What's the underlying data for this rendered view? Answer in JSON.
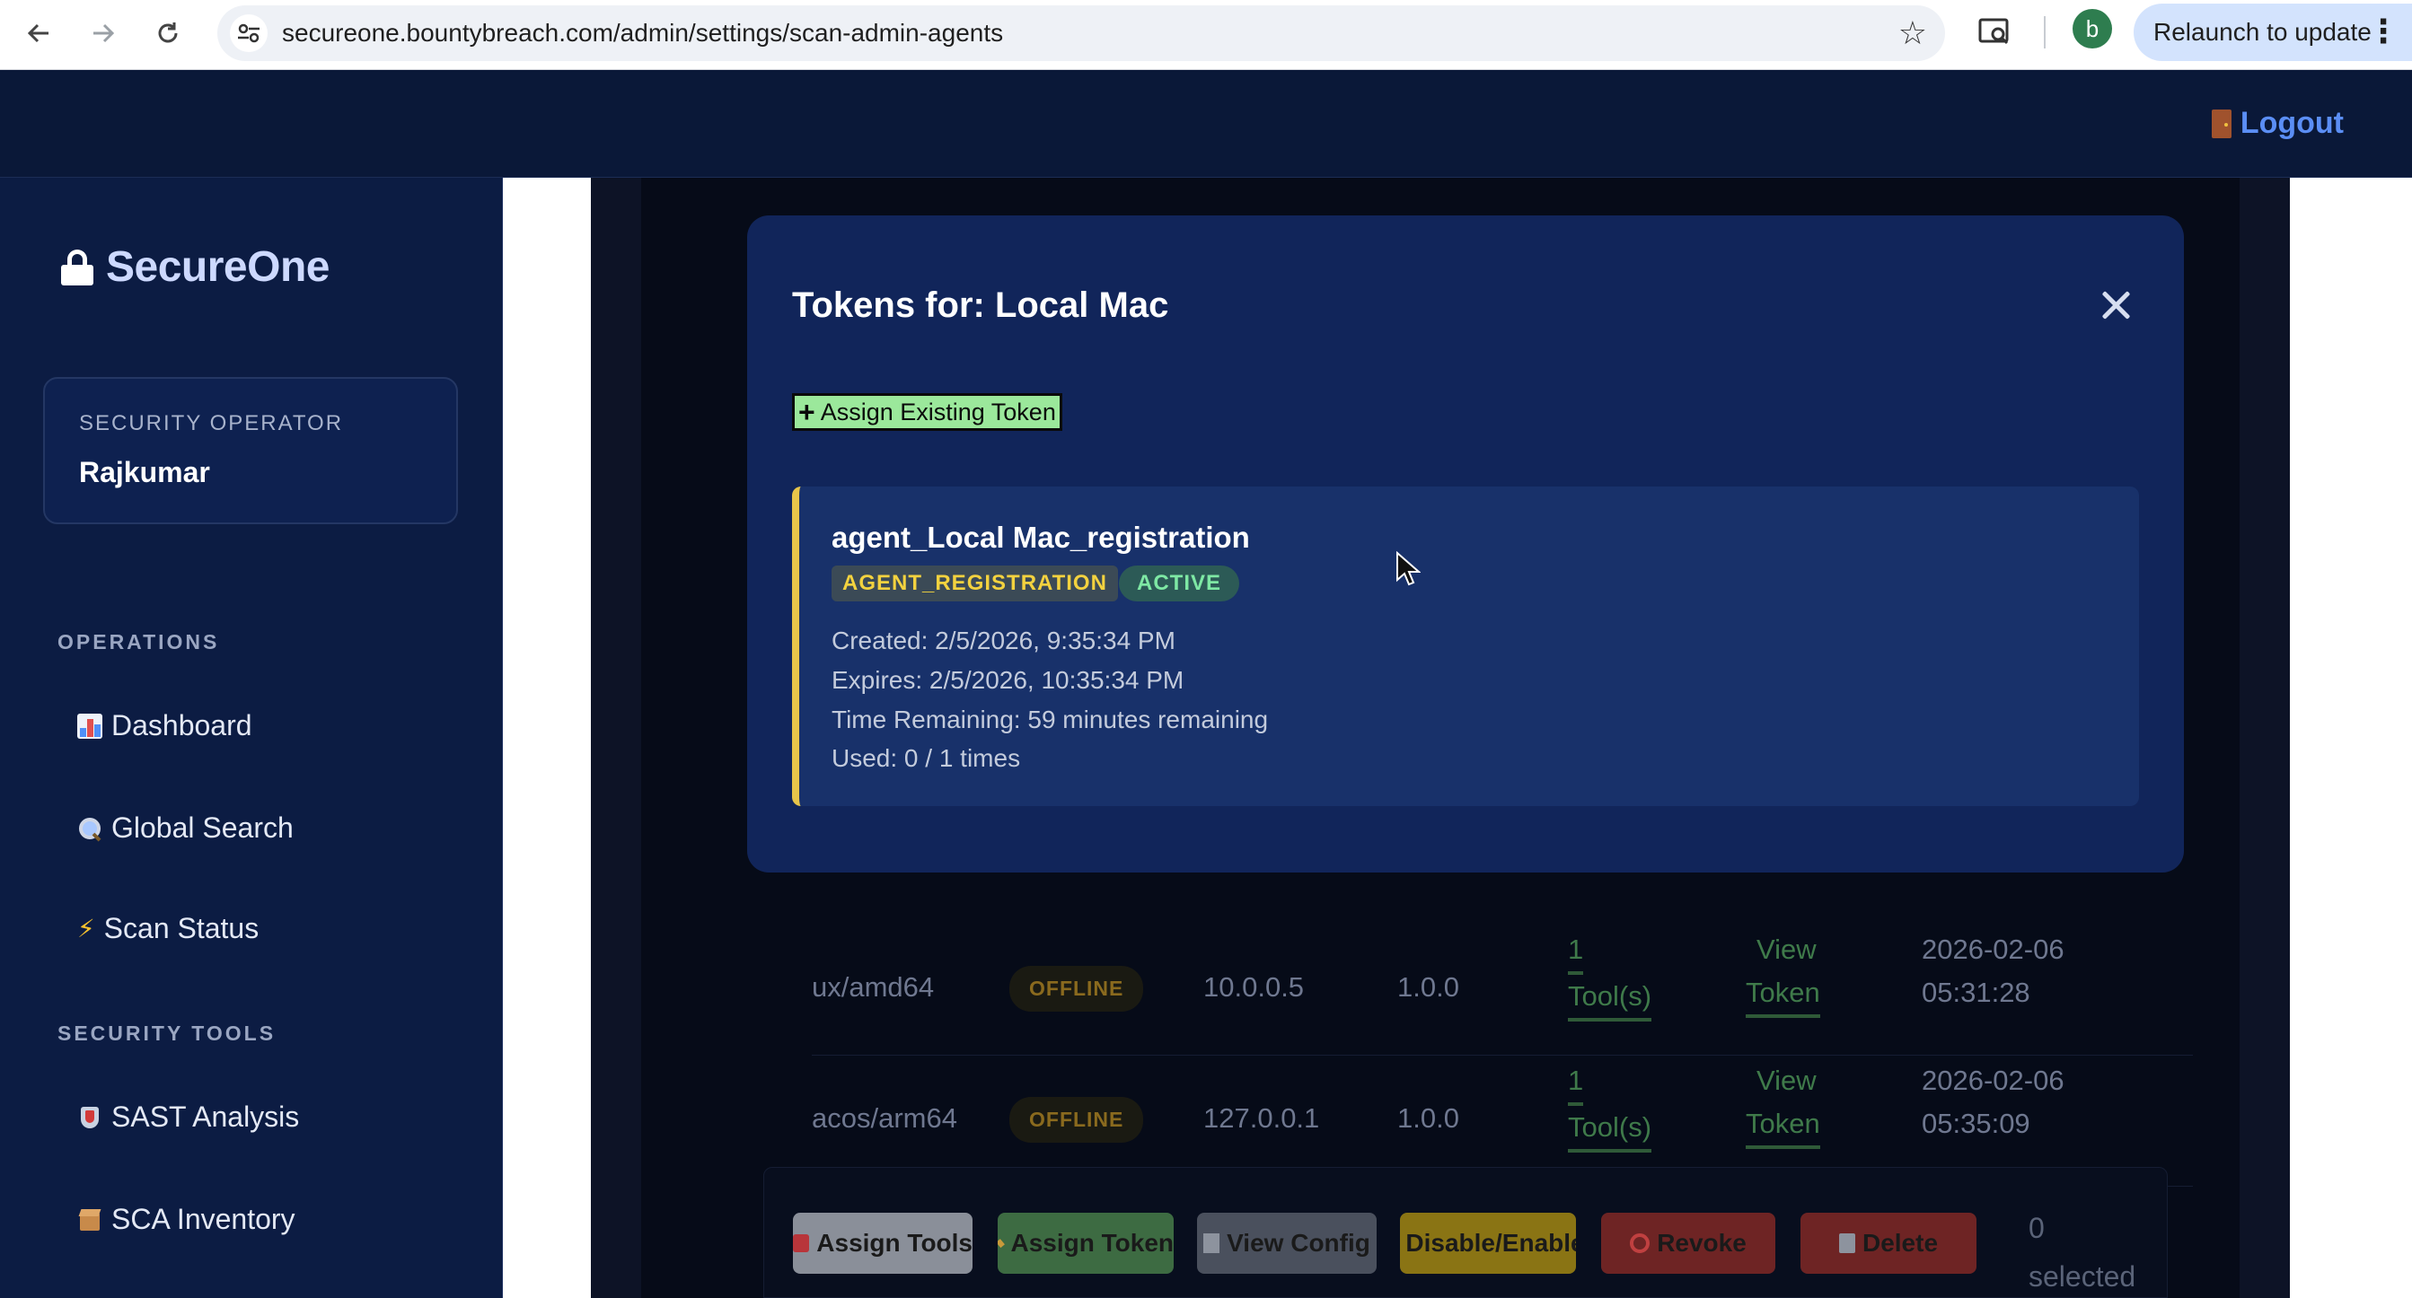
{
  "browser": {
    "url": "secureone.bountybreach.com/admin/settings/scan-admin-agents",
    "profile_initial": "b",
    "relaunch_label": "Relaunch to update"
  },
  "topbar": {
    "logout_label": "Logout"
  },
  "sidebar": {
    "brand": "SecureOne",
    "user": {
      "role": "SECURITY OPERATOR",
      "name": "Rajkumar"
    },
    "sections": [
      {
        "title": "OPERATIONS",
        "items": [
          "Dashboard",
          "Global Search",
          "Scan Status"
        ]
      },
      {
        "title": "SECURITY TOOLS",
        "items": [
          "SAST Analysis",
          "SCA Inventory"
        ]
      }
    ]
  },
  "background_table": {
    "rows": [
      {
        "platform": "ux/amd64",
        "status": "OFFLINE",
        "ip": "10.0.0.5",
        "version": "1.0.0",
        "tools_count": "1",
        "tools_label": "Tool(s)",
        "view": "View",
        "token": "Token",
        "date": "2026-02-06",
        "time": "05:31:28"
      },
      {
        "platform": "acos/arm64",
        "status": "OFFLINE",
        "ip": "127.0.0.1",
        "version": "1.0.0",
        "tools_count": "1",
        "tools_label": "Tool(s)",
        "view": "View",
        "token": "Token",
        "date": "2026-02-06",
        "time": "05:35:09"
      }
    ]
  },
  "bulk_actions": {
    "buttons": [
      "Assign Tools",
      "Assign Token",
      "View Config",
      "Disable/Enable",
      "Revoke",
      "Delete"
    ],
    "selected_count": "0",
    "selected_label": "selected"
  },
  "modal": {
    "title": "Tokens for: Local Mac",
    "assign_label": "Assign Existing Token",
    "token": {
      "name": "agent_Local Mac_registration",
      "type": "AGENT_REGISTRATION",
      "status": "ACTIVE",
      "created": "Created: 2/5/2026, 9:35:34 PM",
      "expires": "Expires: 2/5/2026, 10:35:34 PM",
      "remaining": "Time Remaining: 59 minutes remaining",
      "used": "Used: 0 / 1 times"
    }
  },
  "colors": {
    "sidebar_bg": "#0c1c43",
    "modal_bg": "#11255a",
    "token_card_bg": "#18316a",
    "accent_yellow": "#e7c54a",
    "link_blue": "#5b8ef5",
    "assign_green": "#9be89b"
  }
}
